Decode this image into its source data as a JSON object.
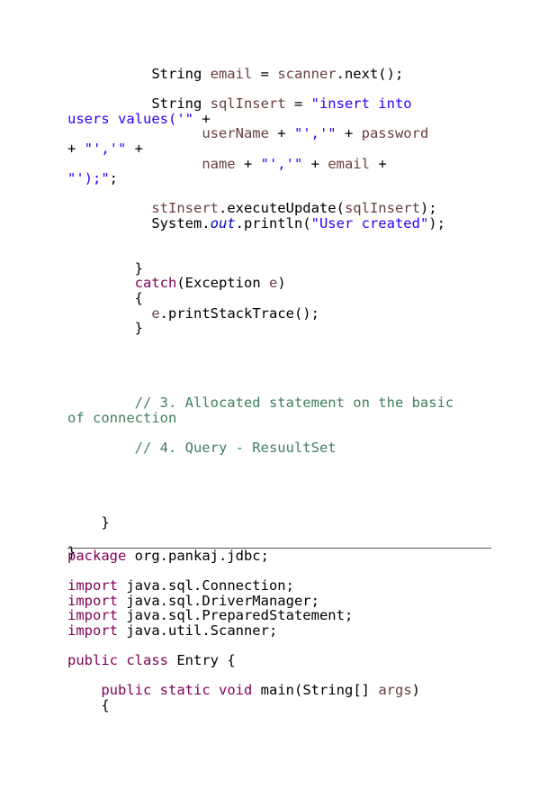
{
  "page1": {
    "lines": [
      {
        "t": [
          {
            "s": "          String "
          },
          {
            "s": "email",
            "c": "var"
          },
          {
            "s": " = "
          },
          {
            "s": "scanner",
            "c": "var"
          },
          {
            "s": ".next();"
          }
        ]
      },
      {
        "t": []
      },
      {
        "t": [
          {
            "s": "          String "
          },
          {
            "s": "sqlInsert",
            "c": "var"
          },
          {
            "s": " = "
          },
          {
            "s": "\"insert into",
            "c": "str"
          }
        ]
      },
      {
        "t": [
          {
            "s": "users values('\"",
            "c": "str"
          },
          {
            "s": " +"
          }
        ]
      },
      {
        "t": [
          {
            "s": "                "
          },
          {
            "s": "userName",
            "c": "var"
          },
          {
            "s": " + "
          },
          {
            "s": "\"','\"",
            "c": "str"
          },
          {
            "s": " + "
          },
          {
            "s": "password",
            "c": "var"
          }
        ]
      },
      {
        "t": [
          {
            "s": "+ "
          },
          {
            "s": "\"','\"",
            "c": "str"
          },
          {
            "s": " +"
          }
        ]
      },
      {
        "t": [
          {
            "s": "                "
          },
          {
            "s": "name",
            "c": "var"
          },
          {
            "s": " + "
          },
          {
            "s": "\"','\"",
            "c": "str"
          },
          {
            "s": " + "
          },
          {
            "s": "email",
            "c": "var"
          },
          {
            "s": " +"
          }
        ]
      },
      {
        "t": [
          {
            "s": "\"');\"",
            "c": "str"
          },
          {
            "s": ";"
          }
        ]
      },
      {
        "t": []
      },
      {
        "t": [
          {
            "s": "          "
          },
          {
            "s": "stInsert",
            "c": "var"
          },
          {
            "s": ".executeUpdate("
          },
          {
            "s": "sqlInsert",
            "c": "var"
          },
          {
            "s": ");"
          }
        ]
      },
      {
        "t": [
          {
            "s": "          System."
          },
          {
            "s": "out",
            "c": "fld"
          },
          {
            "s": ".println("
          },
          {
            "s": "\"User created\"",
            "c": "str"
          },
          {
            "s": ");"
          }
        ]
      },
      {
        "t": []
      },
      {
        "t": []
      },
      {
        "t": [
          {
            "s": "        }"
          }
        ]
      },
      {
        "t": [
          {
            "s": "        "
          },
          {
            "s": "catch",
            "c": "kw"
          },
          {
            "s": "(Exception "
          },
          {
            "s": "e",
            "c": "var"
          },
          {
            "s": ")"
          }
        ]
      },
      {
        "t": [
          {
            "s": "        {"
          }
        ]
      },
      {
        "t": [
          {
            "s": "          "
          },
          {
            "s": "e",
            "c": "var"
          },
          {
            "s": ".printStackTrace();"
          }
        ]
      },
      {
        "t": [
          {
            "s": "        }"
          }
        ]
      },
      {
        "t": []
      },
      {
        "t": []
      },
      {
        "t": []
      },
      {
        "t": []
      },
      {
        "t": [
          {
            "s": "        "
          },
          {
            "s": "// 3. Allocated statement on the basic",
            "c": "cmt"
          }
        ]
      },
      {
        "t": [
          {
            "s": "of connection",
            "c": "cmt"
          }
        ]
      },
      {
        "t": []
      },
      {
        "t": [
          {
            "s": "        "
          },
          {
            "s": "// 4. Query - ResuultSet",
            "c": "cmt"
          }
        ]
      },
      {
        "t": []
      },
      {
        "t": []
      },
      {
        "t": []
      },
      {
        "t": []
      },
      {
        "t": [
          {
            "s": "    }"
          }
        ]
      },
      {
        "t": []
      },
      {
        "t": [
          {
            "s": "}"
          }
        ]
      }
    ]
  },
  "page2": {
    "lines": [
      {
        "t": [
          {
            "s": "package",
            "c": "kw"
          },
          {
            "s": " org.pankaj.jdbc;"
          }
        ]
      },
      {
        "t": []
      },
      {
        "t": [
          {
            "s": "import",
            "c": "kw"
          },
          {
            "s": " java.sql.Connection;"
          }
        ]
      },
      {
        "t": [
          {
            "s": "import",
            "c": "kw"
          },
          {
            "s": " java.sql.DriverManager;"
          }
        ]
      },
      {
        "t": [
          {
            "s": "import",
            "c": "kw"
          },
          {
            "s": " java.sql.PreparedStatement;"
          }
        ]
      },
      {
        "t": [
          {
            "s": "import",
            "c": "kw"
          },
          {
            "s": " java.util.Scanner;"
          }
        ]
      },
      {
        "t": []
      },
      {
        "t": [
          {
            "s": "public",
            "c": "kw"
          },
          {
            "s": " "
          },
          {
            "s": "class",
            "c": "kw"
          },
          {
            "s": " Entry {"
          }
        ]
      },
      {
        "t": []
      },
      {
        "t": [
          {
            "s": "    "
          },
          {
            "s": "public",
            "c": "kw"
          },
          {
            "s": " "
          },
          {
            "s": "static",
            "c": "kw"
          },
          {
            "s": " "
          },
          {
            "s": "void",
            "c": "kw"
          },
          {
            "s": " main(String[] "
          },
          {
            "s": "args",
            "c": "var"
          },
          {
            "s": ")"
          }
        ]
      },
      {
        "t": [
          {
            "s": "    {"
          }
        ]
      }
    ]
  },
  "colors": {
    "keyword": "#7f0055",
    "variable": "#6a3e3e",
    "string": "#2a00ff",
    "comment": "#3f7f5f",
    "static_field": "#0000c0"
  }
}
